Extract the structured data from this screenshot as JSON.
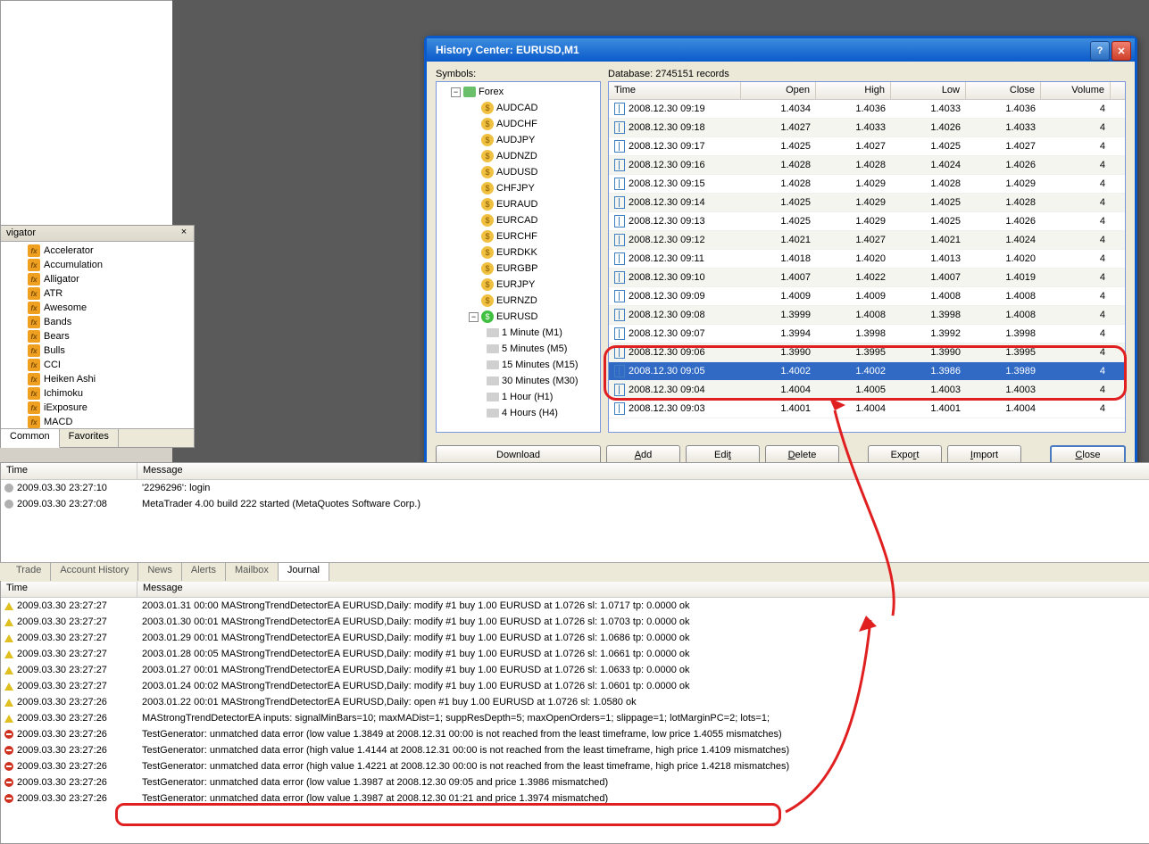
{
  "navigator": {
    "title": "vigator",
    "items": [
      "Accelerator",
      "Accumulation",
      "Alligator",
      "ATR",
      "Awesome",
      "Bands",
      "Bears",
      "Bulls",
      "CCI",
      "Heiken Ashi",
      "Ichimoku",
      "iExposure",
      "MACD"
    ],
    "tabs": {
      "common": "Common",
      "favorites": "Favorites"
    }
  },
  "dialog": {
    "title": "History Center: EURUSD,M1",
    "symbols_label": "Symbols:",
    "db_label": "Database: 2745151 records",
    "tree_root": "Forex",
    "currencies": [
      "AUDCAD",
      "AUDCHF",
      "AUDJPY",
      "AUDNZD",
      "AUDUSD",
      "CHFJPY",
      "EURAUD",
      "EURCAD",
      "EURCHF",
      "EURDKK",
      "EURGBP",
      "EURJPY",
      "EURNZD",
      "EURUSD"
    ],
    "timeframes": [
      "1 Minute (M1)",
      "5 Minutes (M5)",
      "15 Minutes (M15)",
      "30 Minutes (M30)",
      "1 Hour (H1)",
      "4 Hours (H4)"
    ],
    "grid_headers": {
      "time": "Time",
      "open": "Open",
      "high": "High",
      "low": "Low",
      "close": "Close",
      "volume": "Volume"
    },
    "rows": [
      {
        "time": "2008.12.30 09:19",
        "o": "1.4034",
        "h": "1.4036",
        "l": "1.4033",
        "c": "1.4036",
        "v": "4"
      },
      {
        "time": "2008.12.30 09:18",
        "o": "1.4027",
        "h": "1.4033",
        "l": "1.4026",
        "c": "1.4033",
        "v": "4"
      },
      {
        "time": "2008.12.30 09:17",
        "o": "1.4025",
        "h": "1.4027",
        "l": "1.4025",
        "c": "1.4027",
        "v": "4"
      },
      {
        "time": "2008.12.30 09:16",
        "o": "1.4028",
        "h": "1.4028",
        "l": "1.4024",
        "c": "1.4026",
        "v": "4"
      },
      {
        "time": "2008.12.30 09:15",
        "o": "1.4028",
        "h": "1.4029",
        "l": "1.4028",
        "c": "1.4029",
        "v": "4"
      },
      {
        "time": "2008.12.30 09:14",
        "o": "1.4025",
        "h": "1.4029",
        "l": "1.4025",
        "c": "1.4028",
        "v": "4"
      },
      {
        "time": "2008.12.30 09:13",
        "o": "1.4025",
        "h": "1.4029",
        "l": "1.4025",
        "c": "1.4026",
        "v": "4"
      },
      {
        "time": "2008.12.30 09:12",
        "o": "1.4021",
        "h": "1.4027",
        "l": "1.4021",
        "c": "1.4024",
        "v": "4"
      },
      {
        "time": "2008.12.30 09:11",
        "o": "1.4018",
        "h": "1.4020",
        "l": "1.4013",
        "c": "1.4020",
        "v": "4"
      },
      {
        "time": "2008.12.30 09:10",
        "o": "1.4007",
        "h": "1.4022",
        "l": "1.4007",
        "c": "1.4019",
        "v": "4"
      },
      {
        "time": "2008.12.30 09:09",
        "o": "1.4009",
        "h": "1.4009",
        "l": "1.4008",
        "c": "1.4008",
        "v": "4"
      },
      {
        "time": "2008.12.30 09:08",
        "o": "1.3999",
        "h": "1.4008",
        "l": "1.3998",
        "c": "1.4008",
        "v": "4"
      },
      {
        "time": "2008.12.30 09:07",
        "o": "1.3994",
        "h": "1.3998",
        "l": "1.3992",
        "c": "1.3998",
        "v": "4"
      },
      {
        "time": "2008.12.30 09:06",
        "o": "1.3990",
        "h": "1.3995",
        "l": "1.3990",
        "c": "1.3995",
        "v": "4"
      },
      {
        "time": "2008.12.30 09:05",
        "o": "1.4002",
        "h": "1.4002",
        "l": "1.3986",
        "c": "1.3989",
        "v": "4",
        "sel": true
      },
      {
        "time": "2008.12.30 09:04",
        "o": "1.4004",
        "h": "1.4005",
        "l": "1.4003",
        "c": "1.4003",
        "v": "4"
      },
      {
        "time": "2008.12.30 09:03",
        "o": "1.4001",
        "h": "1.4004",
        "l": "1.4001",
        "c": "1.4004",
        "v": "4"
      }
    ],
    "buttons": {
      "download": "Download",
      "add": "Add",
      "edit": "Edit",
      "delete": "Delete",
      "export": "Export",
      "import": "Import",
      "close": "Close"
    }
  },
  "log1": {
    "headers": {
      "time": "Time",
      "message": "Message"
    },
    "rows": [
      {
        "ico": "g",
        "t": "2009.03.30 23:27:10",
        "m": "'2296296': login"
      },
      {
        "ico": "g",
        "t": "2009.03.30 23:27:08",
        "m": "MetaTrader 4.00 build 222 started (MetaQuotes Software Corp.)"
      }
    ]
  },
  "log2": {
    "headers": {
      "time": "Time",
      "message": "Message"
    },
    "tabs": [
      "Trade",
      "Account History",
      "News",
      "Alerts",
      "Mailbox",
      "Journal"
    ],
    "rows": [
      {
        "ico": "w",
        "t": "2009.03.30 23:27:27",
        "m": "2003.01.31 00:00  MAStrongTrendDetectorEA EURUSD,Daily: modify #1 buy 1.00 EURUSD at 1.0726 sl: 1.0717 tp: 0.0000 ok"
      },
      {
        "ico": "w",
        "t": "2009.03.30 23:27:27",
        "m": "2003.01.30 00:01  MAStrongTrendDetectorEA EURUSD,Daily: modify #1 buy 1.00 EURUSD at 1.0726 sl: 1.0703 tp: 0.0000 ok"
      },
      {
        "ico": "w",
        "t": "2009.03.30 23:27:27",
        "m": "2003.01.29 00:01  MAStrongTrendDetectorEA EURUSD,Daily: modify #1 buy 1.00 EURUSD at 1.0726 sl: 1.0686 tp: 0.0000 ok"
      },
      {
        "ico": "w",
        "t": "2009.03.30 23:27:27",
        "m": "2003.01.28 00:05  MAStrongTrendDetectorEA EURUSD,Daily: modify #1 buy 1.00 EURUSD at 1.0726 sl: 1.0661 tp: 0.0000 ok"
      },
      {
        "ico": "w",
        "t": "2009.03.30 23:27:27",
        "m": "2003.01.27 00:01  MAStrongTrendDetectorEA EURUSD,Daily: modify #1 buy 1.00 EURUSD at 1.0726 sl: 1.0633 tp: 0.0000 ok"
      },
      {
        "ico": "w",
        "t": "2009.03.30 23:27:27",
        "m": "2003.01.24 00:02  MAStrongTrendDetectorEA EURUSD,Daily: modify #1 buy 1.00 EURUSD at 1.0726 sl: 1.0601 tp: 0.0000 ok"
      },
      {
        "ico": "w",
        "t": "2009.03.30 23:27:26",
        "m": "2003.01.22 00:01  MAStrongTrendDetectorEA EURUSD,Daily: open #1 buy 1.00 EURUSD at 1.0726 sl: 1.0580 ok"
      },
      {
        "ico": "w",
        "t": "2009.03.30 23:27:26",
        "m": "MAStrongTrendDetectorEA inputs: signalMinBars=10; maxMADist=1; suppResDepth=5; maxOpenOrders=1; slippage=1; lotMarginPC=2; lots=1;"
      },
      {
        "ico": "e",
        "t": "2009.03.30 23:27:26",
        "m": "TestGenerator: unmatched data error (low value 1.3849 at 2008.12.31 00:00 is not reached from the least timeframe, low price 1.4055 mismatches)"
      },
      {
        "ico": "e",
        "t": "2009.03.30 23:27:26",
        "m": "TestGenerator: unmatched data error (high value 1.4144 at 2008.12.31 00:00 is not reached from the least timeframe, high price 1.4109 mismatches)"
      },
      {
        "ico": "e",
        "t": "2009.03.30 23:27:26",
        "m": "TestGenerator: unmatched data error (high value 1.4221 at 2008.12.30 00:00 is not reached from the least timeframe, high price 1.4218 mismatches)"
      },
      {
        "ico": "e",
        "t": "2009.03.30 23:27:26",
        "m": "TestGenerator: unmatched data error (low value 1.3987 at 2008.12.30 09:05 and price 1.3986 mismatched)"
      },
      {
        "ico": "e",
        "t": "2009.03.30 23:27:26",
        "m": "TestGenerator: unmatched data error (low value 1.3987 at 2008.12.30 01:21 and price 1.3974 mismatched)"
      }
    ]
  }
}
